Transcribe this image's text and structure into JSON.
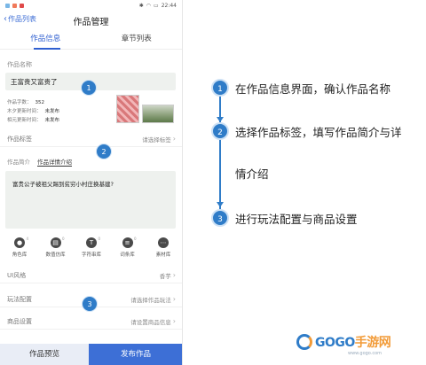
{
  "status_bar": {
    "left_icons": [
      "sim-icon",
      "msg-icon",
      "app-icon"
    ],
    "time": "22:44"
  },
  "nav": {
    "back_label": "作品列表",
    "title": "作品管理"
  },
  "tabs": [
    {
      "label": "作品信息",
      "active": true
    },
    {
      "label": "章节列表",
      "active": false
    }
  ],
  "work_name": {
    "label": "作品名称",
    "value": "王富贵又富贵了"
  },
  "meta": [
    {
      "label": "作品字数：",
      "value": "352"
    },
    {
      "label": "木夕更新时间：",
      "value": "未发布"
    },
    {
      "label": "相元更新时间：",
      "value": "未发布"
    }
  ],
  "tags_row": {
    "label": "作品标签",
    "placeholder": "请选择标签"
  },
  "intro": {
    "subtabs": [
      "作品简介",
      "作品详情介绍"
    ],
    "text": "富贵公子被祖父踢到贫穷小村庄换基建?"
  },
  "tools": [
    {
      "label": "角色库",
      "icon": "person-icon",
      "badge": "4"
    },
    {
      "label": "数值仿库",
      "icon": "chart-icon",
      "badge": "0"
    },
    {
      "label": "字符串库",
      "icon": "text-icon",
      "badge": "0"
    },
    {
      "label": "词条库",
      "icon": "book-icon",
      "badge": "0"
    },
    {
      "label": "素材库",
      "icon": "more-icon",
      "badge": ""
    }
  ],
  "ui_style_row": {
    "label": "UI风格",
    "value": "香芋"
  },
  "gameplay_row": {
    "label": "玩法配置",
    "value": "请选择作品玩法"
  },
  "shop_row": {
    "label": "商品设置",
    "value": "请设置商品信息"
  },
  "bottom": {
    "preview_label": "作品预览",
    "publish_label": "发布作品"
  },
  "markers": [
    "1",
    "2",
    "3"
  ],
  "steps": [
    {
      "num": "1",
      "text": "在作品信息界面，确认作品名称"
    },
    {
      "num": "2",
      "text": "选择作品标签，填写作品简介与详"
    },
    {
      "num": "",
      "text": "情介绍"
    },
    {
      "num": "3",
      "text": "进行玩法配置与商品设置"
    }
  ],
  "watermark": {
    "main": "GOGO",
    "accent": "手游网",
    "sub": "www.gogo.com"
  },
  "colors": {
    "accent": "#2f7cc8",
    "tab_active": "#2f5fd0",
    "publish": "#3d6fd6",
    "watermark_orange": "#f29b38"
  }
}
